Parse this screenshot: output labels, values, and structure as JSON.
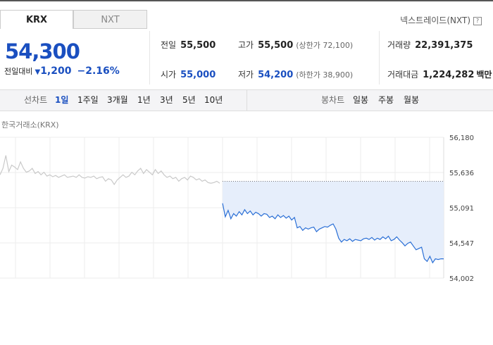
{
  "tabs": [
    {
      "label": "KRX",
      "active": true
    },
    {
      "label": "NXT",
      "active": false
    }
  ],
  "nxt_link": {
    "label": "넥스트레이드(NXT)",
    "help": "?"
  },
  "quote": {
    "price": "54,300",
    "change_label": "전일대비",
    "change_value": "1,200",
    "change_rate": "−2.16%",
    "direction": "down",
    "down_color": "#1a4fc0"
  },
  "stats": {
    "prev_close": {
      "label": "전일",
      "value": "55,500"
    },
    "open": {
      "label": "시가",
      "value": "55,000"
    },
    "high": {
      "label": "고가",
      "value": "55,500",
      "sub": "(상한가 72,100)"
    },
    "low": {
      "label": "저가",
      "value": "54,200",
      "sub": "(하한가 38,900)"
    },
    "volume": {
      "label": "거래량",
      "value": "22,391,375"
    },
    "amount": {
      "label": "거래대금",
      "value": "1,224,282",
      "unit": "백만"
    }
  },
  "toolbar": {
    "line_label": "선차트",
    "ranges": [
      "1일",
      "1주일",
      "3개월",
      "1년",
      "3년",
      "5년",
      "10년"
    ],
    "active_range": "1일",
    "candle_label": "봉차트",
    "candles": [
      "일봉",
      "주봉",
      "월봉"
    ]
  },
  "chart_title": "한국거래소(KRX)",
  "chart_data": {
    "type": "line",
    "y_ticks": [
      "56,180",
      "55,636",
      "55,091",
      "54,547",
      "54,002"
    ],
    "ylim": [
      54002,
      56180
    ],
    "reference_line": 55500,
    "grid": true,
    "series": [
      {
        "color": "#c9c9c9",
        "values": [
          55600,
          55700,
          55900,
          55650,
          55750,
          55720,
          55680,
          55800,
          55700,
          55640,
          55660,
          55700,
          55620,
          55650,
          55600,
          55640,
          55580,
          55600,
          55570,
          55590,
          55560,
          55580,
          55600,
          55560,
          55570,
          55580,
          55560,
          55600,
          55560,
          55550,
          55570,
          55560,
          55580,
          55540,
          55560,
          55570,
          55500,
          55540,
          55520,
          55450,
          55520,
          55560,
          55600,
          55560,
          55580,
          55640,
          55600,
          55660,
          55700,
          55620,
          55680,
          55640,
          55600,
          55680,
          55620,
          55660,
          55600,
          55560,
          55580,
          55540,
          55560,
          55500,
          55540,
          55560,
          55520,
          55580,
          55560,
          55520,
          55540,
          55500,
          55520,
          55480,
          55470,
          55480,
          55500,
          55470
        ]
      },
      {
        "color": "#2a6fd6",
        "fill": "#e6eefb",
        "values": [
          55160,
          54950,
          55050,
          54920,
          55000,
          54960,
          55030,
          54980,
          55060,
          55000,
          55040,
          54980,
          55020,
          55000,
          54960,
          55000,
          54990,
          54940,
          54960,
          54920,
          54980,
          54940,
          54970,
          54930,
          54960,
          54900,
          54940,
          54780,
          54800,
          54740,
          54780,
          54760,
          54780,
          54790,
          54720,
          54760,
          54780,
          54800,
          54790,
          54820,
          54840,
          54760,
          54620,
          54560,
          54600,
          54580,
          54610,
          54570,
          54600,
          54590,
          54580,
          54610,
          54620,
          54600,
          54630,
          54590,
          54620,
          54600,
          54640,
          54610,
          54650,
          54580,
          54600,
          54640,
          54590,
          54550,
          54500,
          54540,
          54560,
          54500,
          54440,
          54460,
          54480,
          54300,
          54260,
          54340,
          54240,
          54300,
          54290,
          54300,
          54300
        ]
      }
    ]
  }
}
